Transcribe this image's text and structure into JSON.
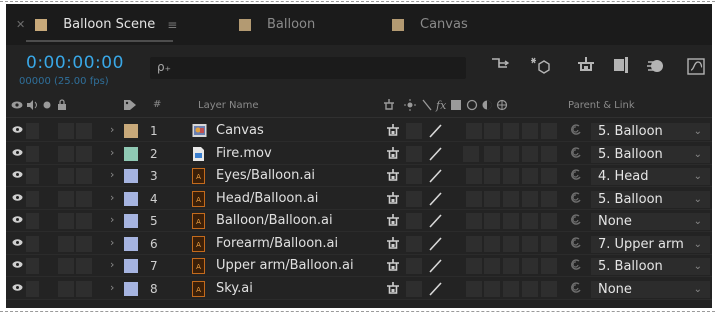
{
  "tabs": [
    {
      "label": "Balloon Scene",
      "active": true,
      "swatch": "#c8a97a",
      "has_close": true,
      "has_menu": true
    },
    {
      "label": "Balloon",
      "active": false,
      "swatch": "#b39a72"
    },
    {
      "label": "Canvas",
      "active": false,
      "swatch": "#b39a72"
    }
  ],
  "header": {
    "timecode": "0:00:00:00",
    "fps": "00000 (25.00 fps)",
    "search_glyph": "ρ₊",
    "tools": [
      "comp-flowchart-icon",
      "draft-3d-icon",
      "shy-layers-icon",
      "frame-blending-icon",
      "motion-blur-icon",
      "graph-editor-icon"
    ]
  },
  "columns": {
    "switches_icons": [
      "eye-icon",
      "audio-icon",
      "solo-icon",
      "lock-icon"
    ],
    "label_icon": "label-tag-icon",
    "hash": "#",
    "layer_name": "Layer Name",
    "parent": "Parent & Link"
  },
  "layers": [
    {
      "num": "1",
      "name": "Canvas",
      "label_color": "#c8a97a",
      "icon": "comp-icon",
      "parent": "5. Balloon"
    },
    {
      "num": "2",
      "name": "Fire.mov",
      "label_color": "#8fc9b4",
      "icon": "footage-icon",
      "parent": "5. Balloon"
    },
    {
      "num": "3",
      "name": "Eyes/Balloon.ai",
      "label_color": "#a6b4e0",
      "icon": "ai-file-icon",
      "parent": "4. Head"
    },
    {
      "num": "4",
      "name": "Head/Balloon.ai",
      "label_color": "#a6b4e0",
      "icon": "ai-file-icon",
      "parent": "5. Balloon"
    },
    {
      "num": "5",
      "name": "Balloon/Balloon.ai",
      "label_color": "#a6b4e0",
      "icon": "ai-file-icon",
      "parent": "None"
    },
    {
      "num": "6",
      "name": "Forearm/Balloon.ai",
      "label_color": "#a6b4e0",
      "icon": "ai-file-icon",
      "parent": "7. Upper arm"
    },
    {
      "num": "7",
      "name": "Upper arm/Balloon.ai",
      "label_color": "#a6b4e0",
      "icon": "ai-file-icon",
      "parent": "5. Balloon"
    },
    {
      "num": "8",
      "name": "Sky.ai",
      "label_color": "#a6b4e0",
      "icon": "ai-file-icon",
      "parent": "None"
    }
  ],
  "colors": {
    "accent": "#39a7e6",
    "panel": "#232323",
    "tabbar": "#1b1b1b"
  }
}
